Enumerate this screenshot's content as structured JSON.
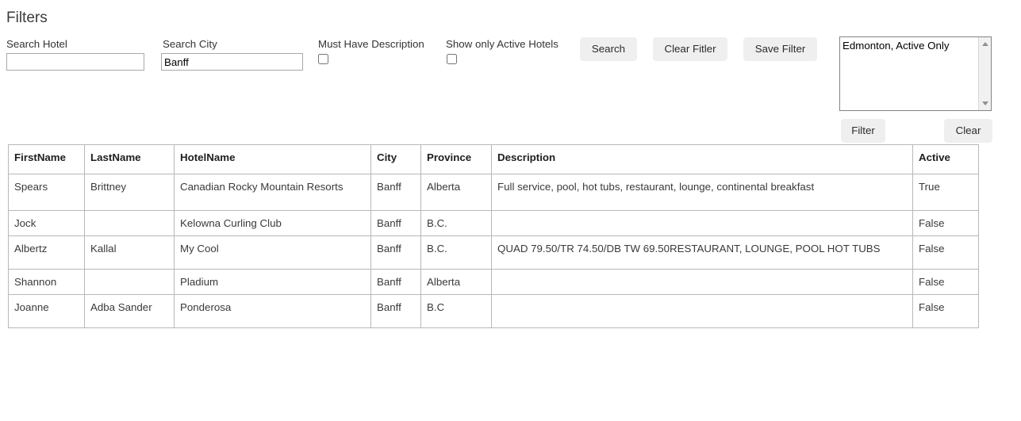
{
  "filters": {
    "heading": "Filters",
    "search_hotel": {
      "label": "Search Hotel",
      "value": "",
      "placeholder": ""
    },
    "search_city": {
      "label": "Search City",
      "value": "Banff",
      "placeholder": ""
    },
    "must_have_description": {
      "label": "Must Have Description",
      "checked": false
    },
    "show_only_active_hotels": {
      "label": "Show only Active Hotels",
      "checked": false
    },
    "buttons": {
      "search": "Search",
      "clear_filter": "Clear Fitler",
      "save_filter": "Save Filter",
      "apply_filter": "Filter",
      "clear": "Clear"
    },
    "saved_filters": {
      "options": [
        "Edmonton, Active Only"
      ],
      "selected": "Edmonton, Active Only"
    }
  },
  "table": {
    "columns": [
      "FirstName",
      "LastName",
      "HotelName",
      "City",
      "Province",
      "Description",
      "Active"
    ],
    "rows": [
      {
        "firstname": "Spears",
        "lastname": "Brittney",
        "hotelname": "Canadian Rocky Mountain Resorts",
        "city": "Banff",
        "province": "Alberta",
        "description": "Full service, pool, hot tubs, restaurant, lounge, continental breakfast",
        "active": "True"
      },
      {
        "firstname": "Jock",
        "lastname": "",
        "hotelname": "Kelowna Curling Club",
        "city": "Banff",
        "province": "B.C.",
        "description": "",
        "active": "False"
      },
      {
        "firstname": "Albertz",
        "lastname": "Kallal",
        "hotelname": "My Cool",
        "city": "Banff",
        "province": "B.C.",
        "description": "QUAD 79.50/TR 74.50/DB TW 69.50RESTAURANT, LOUNGE, POOL HOT TUBS",
        "active": "False"
      },
      {
        "firstname": "Shannon",
        "lastname": "",
        "hotelname": "Pladium",
        "city": "Banff",
        "province": "Alberta",
        "description": "",
        "active": "False"
      },
      {
        "firstname": "Joanne",
        "lastname": "Adba Sander",
        "hotelname": "Ponderosa",
        "city": "Banff",
        "province": "B.C",
        "description": "",
        "active": "False"
      }
    ]
  }
}
